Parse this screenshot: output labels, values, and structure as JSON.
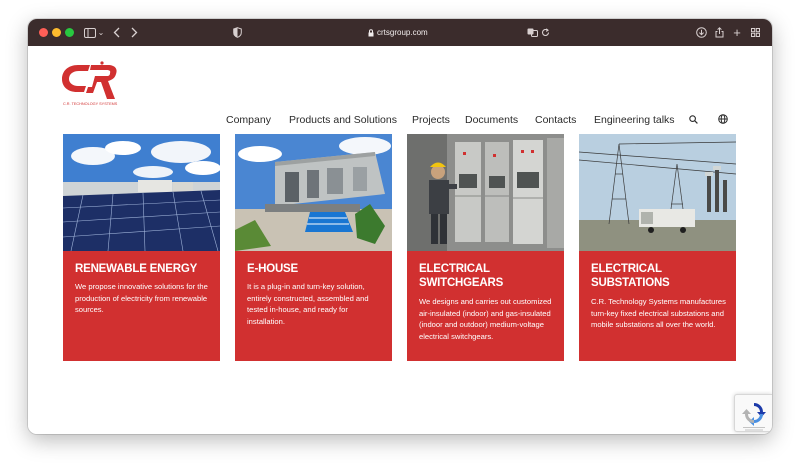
{
  "browser": {
    "url": "crtsgroup.com",
    "traffic_lights": [
      "#ff5f57",
      "#febc2e",
      "#28c840"
    ]
  },
  "site": {
    "logo_text": "C.R. TECHNOLOGY SYSTEMS",
    "brand_color": "#d13030",
    "nav": [
      {
        "label": "Company"
      },
      {
        "label": "Products and Solutions"
      },
      {
        "label": "Projects"
      },
      {
        "label": "Documents"
      },
      {
        "label": "Contacts"
      },
      {
        "label": "Engineering talks"
      }
    ],
    "search_icon": "search-icon",
    "language_icon": "globe-icon"
  },
  "cards": [
    {
      "title": "RENEWABLE ENERGY",
      "description": "We propose innovative solutions for the production of electricity from renewable sources.",
      "image": "solar-panels-photo"
    },
    {
      "title": "E-HOUSE",
      "description": "It is a plug-in and turn-key solution, entirely constructed, assembled and tested in-house, and ready for installation.",
      "image": "e-house-container-photo"
    },
    {
      "title": "ELECTRICAL SWITCHGEARS",
      "description": "We designs and carries out customized air-insulated (indoor) and gas-insulated (indoor and outdoor) medium-voltage electrical switchgears.",
      "image": "switchgear-technician-photo"
    },
    {
      "title": "ELECTRICAL SUBSTATIONS",
      "description": "C.R. Technology Systems manufactures turn-key fixed electrical substations and mobile substations all over the world.",
      "image": "substation-photo"
    }
  ],
  "recaptcha": {
    "icon": "recaptcha-icon"
  }
}
